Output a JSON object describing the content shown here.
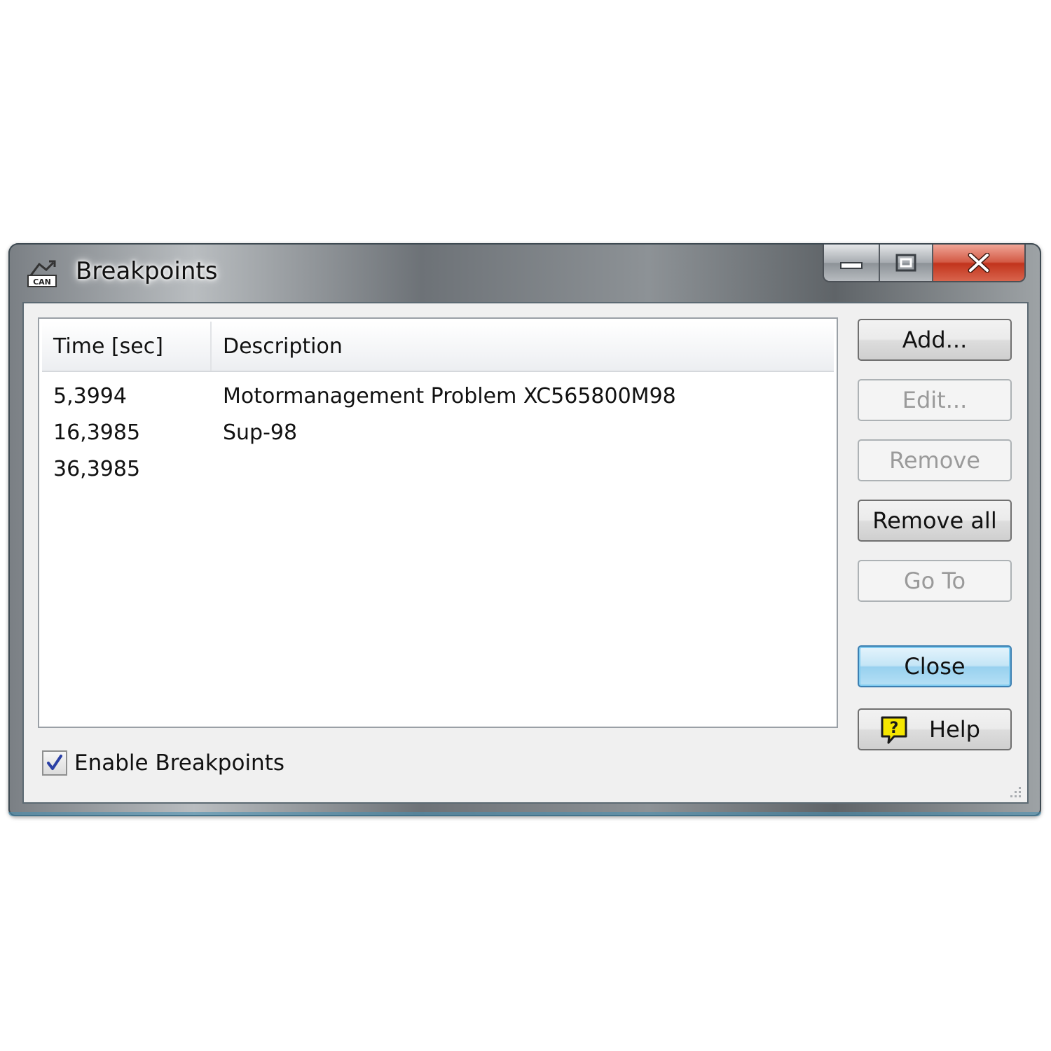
{
  "window": {
    "title": "Breakpoints",
    "app_icon": "can-app-icon",
    "caption": {
      "minimize_icon": "minimize-icon",
      "maximize_icon": "maximize-icon",
      "close_icon": "close-icon"
    }
  },
  "table": {
    "columns": [
      "Time [sec]",
      "Description"
    ],
    "rows": [
      {
        "time": "5,3994",
        "description": "Motormanagement Problem XC565800M98"
      },
      {
        "time": "16,3985",
        "description": "Sup-98"
      },
      {
        "time": "36,3985",
        "description": ""
      }
    ]
  },
  "buttons": {
    "add": {
      "label": "Add...",
      "enabled": true
    },
    "edit": {
      "label": "Edit...",
      "enabled": false
    },
    "remove": {
      "label": "Remove",
      "enabled": false
    },
    "remove_all": {
      "label": "Remove all",
      "enabled": true
    },
    "go_to": {
      "label": "Go To",
      "enabled": false
    },
    "close": {
      "label": "Close",
      "enabled": true,
      "default": true
    },
    "help": {
      "label": "Help",
      "icon": "help-icon",
      "enabled": true
    }
  },
  "enable_breakpoints": {
    "label": "Enable Breakpoints",
    "checked": true
  },
  "colors": {
    "close_button": "#c2331c",
    "default_button": "#98d1ef",
    "help_icon": "#f5e600",
    "checkmark": "#2a3fa5"
  }
}
